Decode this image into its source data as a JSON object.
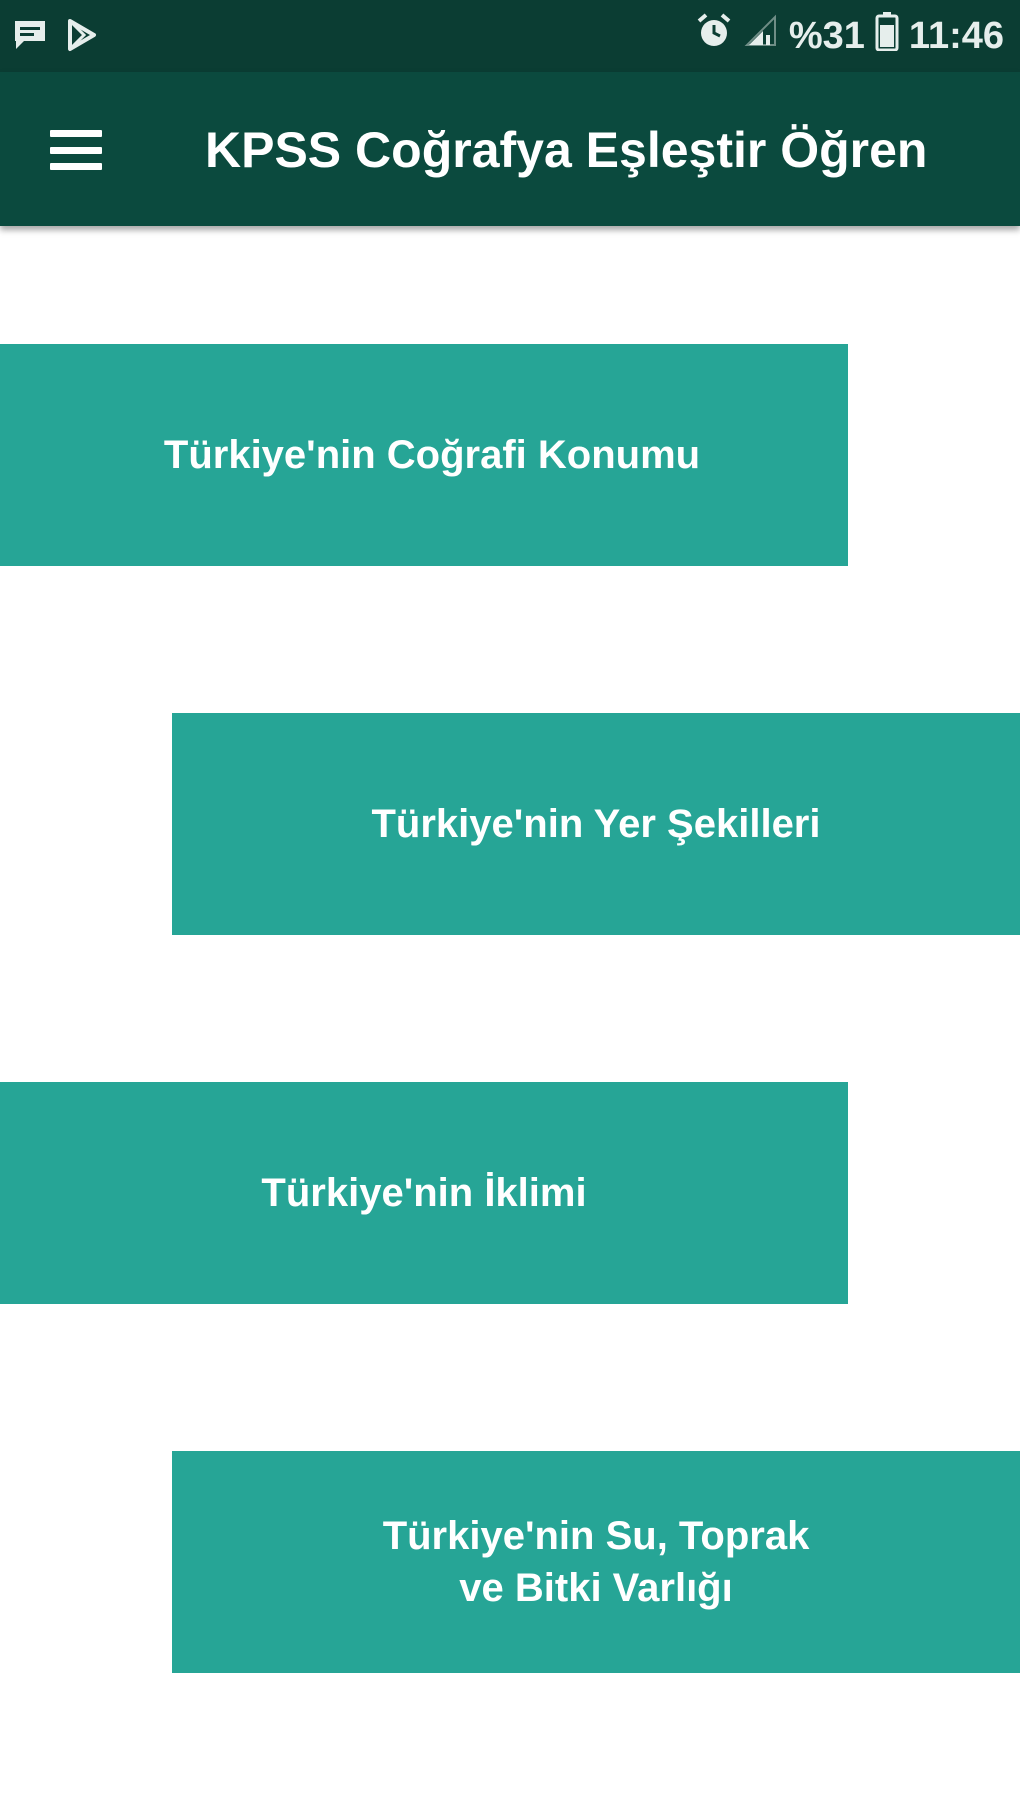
{
  "status_bar": {
    "left_icons": [
      "message-icon",
      "play-store-icon"
    ],
    "right_icons": [
      "alarm-icon",
      "signal-icon",
      "battery-icon"
    ],
    "battery_percent": "%31",
    "time": "11:46"
  },
  "app_bar": {
    "menu_icon": "menu-icon",
    "title": "KPSS Coğrafya Eşleştir Öğren"
  },
  "topics": [
    {
      "label": "Türkiye'nin Coğrafi Konumu"
    },
    {
      "label": "Türkiye'nin Yer Şekilleri"
    },
    {
      "label": "Türkiye'nin İklimi"
    },
    {
      "label": "Türkiye'nin Su, Toprak\nve Bitki Varlığı"
    }
  ],
  "colors": {
    "status_bar": "#0b3d33",
    "app_bar": "#0b4a3e",
    "button": "#26a596",
    "button_text": "#ffffff"
  }
}
